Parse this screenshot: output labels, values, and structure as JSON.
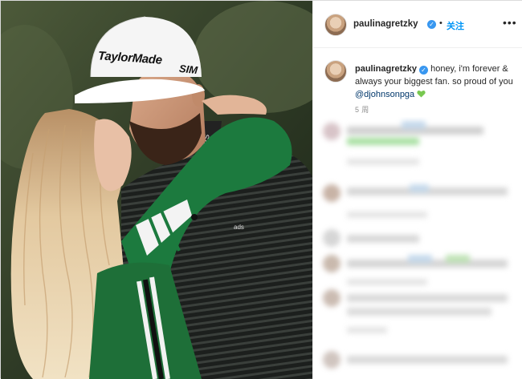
{
  "post": {
    "image_logo_text": "TaylorMade",
    "image_logo_text2": "SIM"
  },
  "header": {
    "username": "paulinagretzky",
    "separator": "•",
    "follow_label": "关注",
    "more_label": "•••"
  },
  "caption": {
    "username": "paulinagretzky",
    "text_before": " honey, i'm forever & always your biggest fan. so proud of you ",
    "mention": "@djohnsonpga",
    "emoji": "green-heart"
  },
  "meta": {
    "time": "5 周"
  },
  "comments": {
    "rows": 10,
    "state": "blurred"
  },
  "colors": {
    "accent": "#0095f6",
    "verified": "#3897f0",
    "heart": "#78c850",
    "text": "#262626",
    "muted": "#8e8e8e"
  }
}
